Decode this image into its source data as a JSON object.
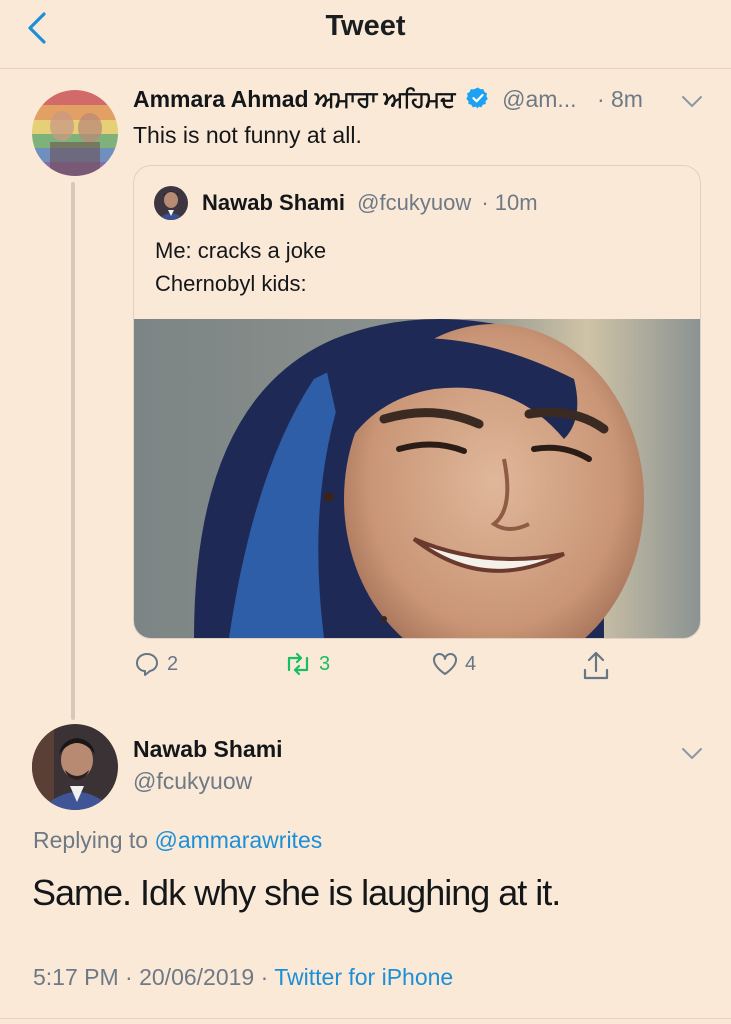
{
  "header": {
    "title": "Tweet",
    "back_icon": "chevron-left-icon"
  },
  "tweet": {
    "author_name": "Ammara Ahmad ਅਮਾਰਾ ਅਹਿਮਦ",
    "handle": "@am...",
    "time": "· 8m",
    "text": "This is not funny at all.",
    "verified": true
  },
  "quoted": {
    "author_name": "Nawab Shami",
    "handle": "@fcukyuow",
    "time": "· 10m",
    "line1": "Me: cracks a joke",
    "line2": "Chernobyl kids:"
  },
  "actions": {
    "reply_count": "2",
    "retweet_count": "3",
    "like_count": "4"
  },
  "reply": {
    "author_name": "Nawab Shami",
    "handle": "@fcukyuow",
    "replying_prefix": "Replying to",
    "replying_to": "@ammarawrites",
    "text": "Same. Idk why she is laughing at it.",
    "timestamp": "5:17 PM · 20/06/2019 ·",
    "source": "Twitter for iPhone"
  },
  "colors": {
    "background": "#fbe9d7",
    "link": "#1b8fd8",
    "retweet": "#17bf63",
    "muted": "#6d7a86"
  }
}
